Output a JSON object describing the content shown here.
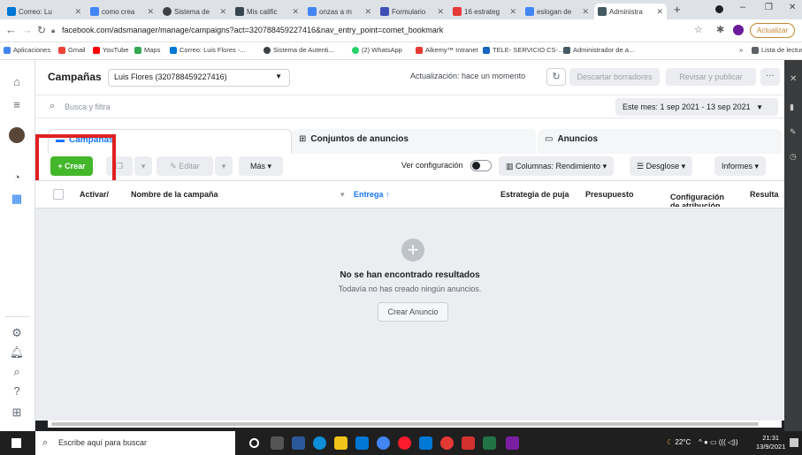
{
  "browser": {
    "tabs": [
      {
        "label": "Correo: Lu",
        "color": "#0078d4"
      },
      {
        "label": "como crea",
        "color": "#4285f4"
      },
      {
        "label": "Sistema de",
        "color": "#3c4043"
      },
      {
        "label": "Mis calific",
        "color": "#37474f"
      },
      {
        "label": "onzas a m",
        "color": "#4285f4"
      },
      {
        "label": "Formulario",
        "color": "#3f51b5"
      },
      {
        "label": "16 estrateg",
        "color": "#e53935"
      },
      {
        "label": "eslogan de",
        "color": "#4285f4"
      },
      {
        "label": "Administra",
        "color": "#455a64"
      }
    ],
    "url": "facebook.com/adsmanager/manage/campaigns?act=320788459227416&nav_entry_point=comet_bookmark",
    "update_label": "Actualizar",
    "bookmarks": [
      "Aplicaciones",
      "Gmail",
      "YouTube",
      "Maps",
      "Correo: Luis Flores -...",
      "Sistema de Autenti...",
      "(2) WhatsApp",
      "Alkemy™ Intranet",
      "TELE- SERVICIO CS-...",
      "Administrador de a...",
      "»",
      "Lista de lectura"
    ]
  },
  "header": {
    "title": "Campañas",
    "account": "Luis Flores (320788459227416)",
    "update_status": "Actualización: hace un momento",
    "discard_label": "Descartar borradores",
    "review_label": "Revisar y publicar",
    "more_label": "···"
  },
  "search": {
    "placeholder": "Busca y filtra",
    "date_range": "Este mes: 1 sep 2021 - 13 sep 2021"
  },
  "tabs": {
    "campaigns": "Campañas",
    "adsets": "Conjuntos de anuncios",
    "ads": "Anuncios"
  },
  "toolbar": {
    "create_label": "+ Crear",
    "edit_label": "Editar",
    "more_label": "Más",
    "view_config_label": "Ver configuración",
    "columns_label": "Columnas: Rendimiento",
    "breakdown_label": "Desglose",
    "reports_label": "Informes"
  },
  "table": {
    "columns": [
      "Activar/",
      "Nombre de la campaña",
      "Entrega ↑",
      "Estrategia de puja",
      "Presupuesto",
      "Configuración de atribución",
      "Resulta"
    ]
  },
  "empty_state": {
    "title": "No se han encontrado resultados",
    "subtitle": "Todavía no has creado ningún anuncios.",
    "button_label": "Crear Anuncio"
  },
  "taskbar": {
    "search_placeholder": "Escribe aquí para buscar",
    "weather": "22°C",
    "time": "21:31",
    "date": "13/9/2021"
  },
  "highlight_color": "#e02020",
  "accent_color": "#1877f2",
  "create_color": "#42b72a"
}
